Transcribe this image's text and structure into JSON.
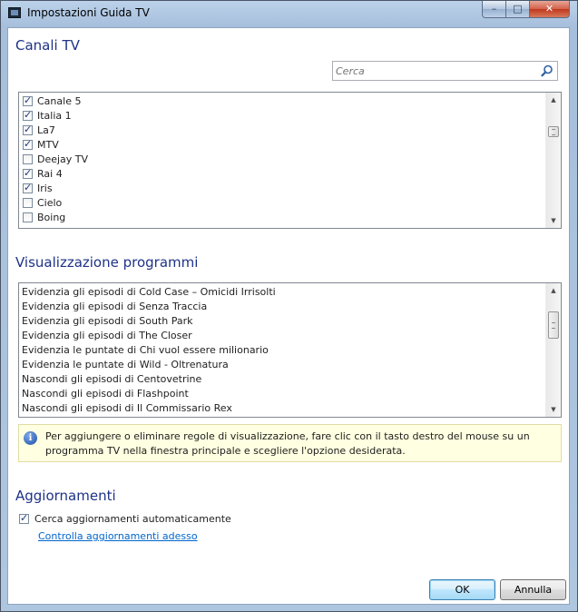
{
  "window": {
    "title": "Impostazioni Guida TV",
    "controls": {
      "minimize": "–",
      "maximize": "□",
      "close": "✕"
    }
  },
  "channels": {
    "section_title": "Canali TV",
    "search_placeholder": "Cerca",
    "items": [
      {
        "label": "Canale 5",
        "checked": true
      },
      {
        "label": "Italia 1",
        "checked": true
      },
      {
        "label": "La7",
        "checked": true
      },
      {
        "label": "MTV",
        "checked": true
      },
      {
        "label": "Deejay TV",
        "checked": false
      },
      {
        "label": "Rai 4",
        "checked": true
      },
      {
        "label": "Iris",
        "checked": true
      },
      {
        "label": "Cielo",
        "checked": false
      },
      {
        "label": "Boing",
        "checked": false
      }
    ],
    "scroll_fraction": 0.2
  },
  "display": {
    "section_title": "Visualizzazione programmi",
    "rules": [
      "Evidenzia gli episodi di Cold Case – Omicidi Irrisolti",
      "Evidenzia gli episodi di Senza Traccia",
      "Evidenzia gli episodi di South Park",
      "Evidenzia gli episodi di The Closer",
      "Evidenzia le puntate di Chi vuol essere milionario",
      "Evidenzia le puntate di Wild - Oltrenatura",
      "Nascondi gli episodi di Centovetrine",
      "Nascondi gli episodi di Flashpoint",
      "Nascondi gli episodi di Il Commissario Rex"
    ],
    "scroll_fraction": 0.15,
    "info_text": "Per aggiungere o eliminare regole di visualizzazione, fare clic con il tasto destro del mouse su un programma TV nella finestra principale e scegliere l'opzione desiderata."
  },
  "updates": {
    "section_title": "Aggiornamenti",
    "auto_check_label": "Cerca aggiornamenti automaticamente",
    "auto_check_checked": true,
    "check_now_link": "Controlla aggiornamenti adesso"
  },
  "buttons": {
    "ok": "OK",
    "cancel": "Annulla"
  },
  "colors": {
    "section_title": "#1e3287",
    "link": "#0066cc",
    "info_background": "#ffffe1"
  }
}
